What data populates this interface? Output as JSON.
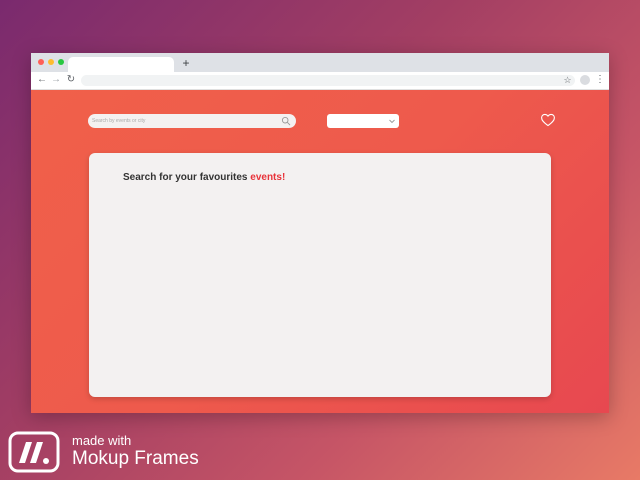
{
  "browser": {
    "new_tab_label": "+",
    "back_glyph": "←",
    "forward_glyph": "→",
    "reload_glyph": "↻",
    "star_glyph": "☆",
    "menu_glyph": "⋮"
  },
  "search": {
    "placeholder": "Search by events or city",
    "value": ""
  },
  "filter_select": {
    "selected": ""
  },
  "card": {
    "headline_prefix": "Search for your favourites ",
    "headline_accent": "events!"
  },
  "icons": [
    "search-icon",
    "chevron-down-icon",
    "heart-icon",
    "star-icon",
    "menu-icon"
  ],
  "colors": {
    "accent": "#e8333a",
    "page_background": "#ee5a4c",
    "card_background": "#f3f1f1"
  },
  "branding": {
    "line1": "made with",
    "line2": "Mokup Frames"
  }
}
